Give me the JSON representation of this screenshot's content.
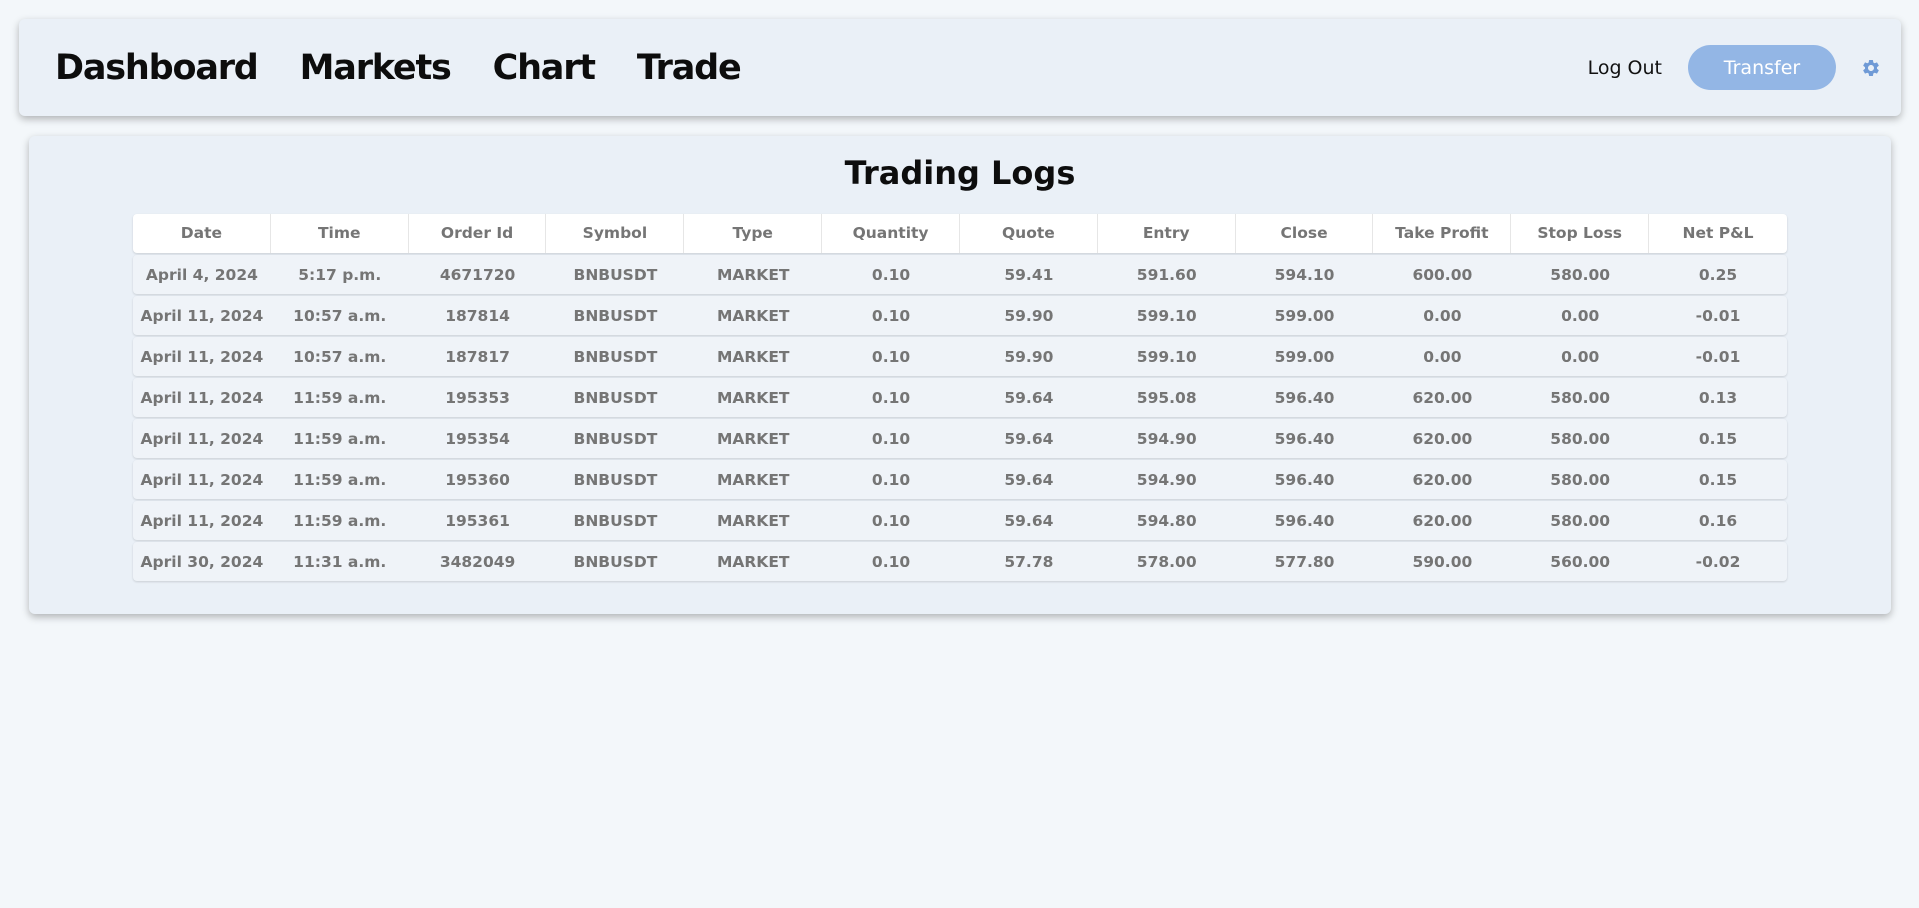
{
  "nav": {
    "links": [
      "Dashboard",
      "Markets",
      "Chart",
      "Trade"
    ],
    "logout": "Log Out",
    "transfer": "Transfer",
    "settings_icon": "gear-icon",
    "accent_color": "#93b6e5"
  },
  "trading_logs": {
    "title": "Trading Logs",
    "columns": [
      "Date",
      "Time",
      "Order Id",
      "Symbol",
      "Type",
      "Quantity",
      "Quote",
      "Entry",
      "Close",
      "Take Profit",
      "Stop Loss",
      "Net P&L"
    ],
    "rows": [
      [
        "April 4, 2024",
        "5:17 p.m.",
        "4671720",
        "BNBUSDT",
        "MARKET",
        "0.10",
        "59.41",
        "591.60",
        "594.10",
        "600.00",
        "580.00",
        "0.25"
      ],
      [
        "April 11, 2024",
        "10:57 a.m.",
        "187814",
        "BNBUSDT",
        "MARKET",
        "0.10",
        "59.90",
        "599.10",
        "599.00",
        "0.00",
        "0.00",
        "-0.01"
      ],
      [
        "April 11, 2024",
        "10:57 a.m.",
        "187817",
        "BNBUSDT",
        "MARKET",
        "0.10",
        "59.90",
        "599.10",
        "599.00",
        "0.00",
        "0.00",
        "-0.01"
      ],
      [
        "April 11, 2024",
        "11:59 a.m.",
        "195353",
        "BNBUSDT",
        "MARKET",
        "0.10",
        "59.64",
        "595.08",
        "596.40",
        "620.00",
        "580.00",
        "0.13"
      ],
      [
        "April 11, 2024",
        "11:59 a.m.",
        "195354",
        "BNBUSDT",
        "MARKET",
        "0.10",
        "59.64",
        "594.90",
        "596.40",
        "620.00",
        "580.00",
        "0.15"
      ],
      [
        "April 11, 2024",
        "11:59 a.m.",
        "195360",
        "BNBUSDT",
        "MARKET",
        "0.10",
        "59.64",
        "594.90",
        "596.40",
        "620.00",
        "580.00",
        "0.15"
      ],
      [
        "April 11, 2024",
        "11:59 a.m.",
        "195361",
        "BNBUSDT",
        "MARKET",
        "0.10",
        "59.64",
        "594.80",
        "596.40",
        "620.00",
        "580.00",
        "0.16"
      ],
      [
        "April 30, 2024",
        "11:31 a.m.",
        "3482049",
        "BNBUSDT",
        "MARKET",
        "0.10",
        "57.78",
        "578.00",
        "577.80",
        "590.00",
        "560.00",
        "-0.02"
      ]
    ]
  }
}
